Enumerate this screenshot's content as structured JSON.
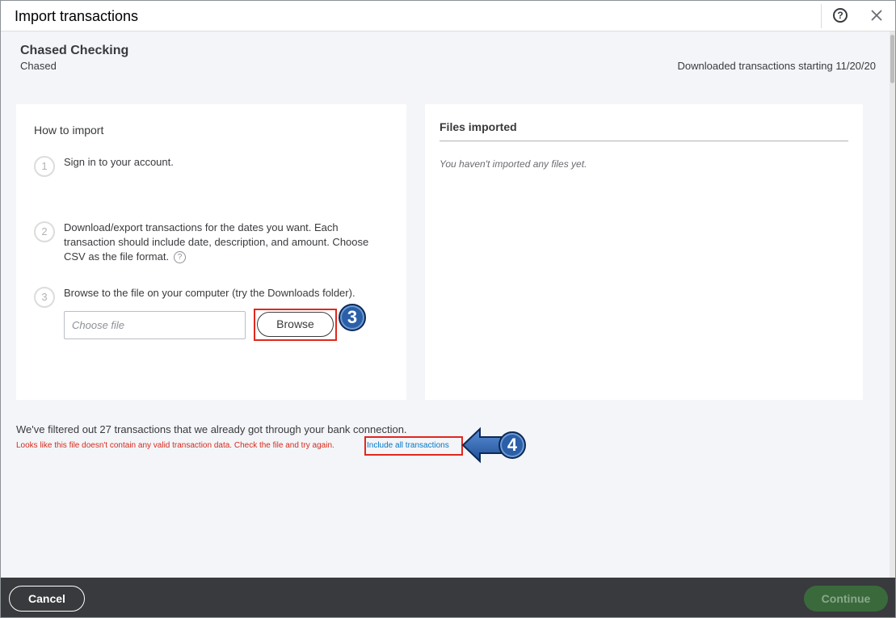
{
  "dialog": {
    "title": "Import transactions",
    "help_label": "?",
    "close_label": "close"
  },
  "account": {
    "name": "Chased Checking",
    "institution": "Chased",
    "download_note": "Downloaded transactions starting 11/20/20"
  },
  "how_to": {
    "title": "How to import",
    "steps": [
      {
        "num": "1",
        "text": "Sign in to your account."
      },
      {
        "num": "2",
        "text": "Download/export transactions for the dates you want. Each transaction should include date, description, and amount. Choose CSV as the file format."
      },
      {
        "num": "3",
        "text": "Browse to the file on your computer (try the Downloads folder)."
      }
    ],
    "info_glyph": "?",
    "file_placeholder": "Choose file",
    "browse_label": "Browse"
  },
  "files": {
    "title": "Files imported",
    "empty": "You haven't imported any files yet."
  },
  "messages": {
    "filtered": "We've filtered out 27 transactions that we already got through your bank connection.",
    "error": "Looks like this file doesn't contain any valid transaction data. Check the file and try again.",
    "include_link": "Include all transactions"
  },
  "callouts": {
    "browse": "3",
    "include": "4"
  },
  "footer": {
    "cancel_label": "Cancel",
    "continue_label": "Continue"
  },
  "colors": {
    "error_red": "#d52b1e",
    "link_blue": "#0077c5",
    "footer_bg": "#393a3d",
    "continue_disabled": "#3a6a3c",
    "callout_blue": "#2b5fa8",
    "highlight_red": "#e0281e"
  }
}
